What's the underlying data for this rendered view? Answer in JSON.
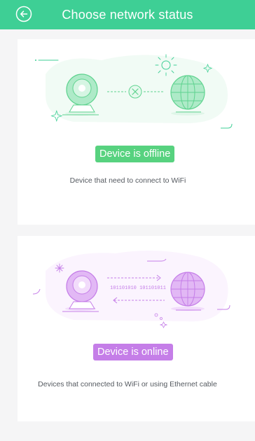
{
  "header": {
    "title": "Choose network status"
  },
  "options": {
    "offline": {
      "label": "Device is offline",
      "description": "Device that need to connect to WiFi",
      "color": "#57d27f"
    },
    "online": {
      "label": "Device is online",
      "description": "Devices that connected to WiFi or using Ethernet cable",
      "color": "#c57ee8",
      "binary_text": "101101010 101101011"
    }
  },
  "colors": {
    "header_bg": "#3ecf95",
    "page_bg": "#f5f5f6"
  }
}
